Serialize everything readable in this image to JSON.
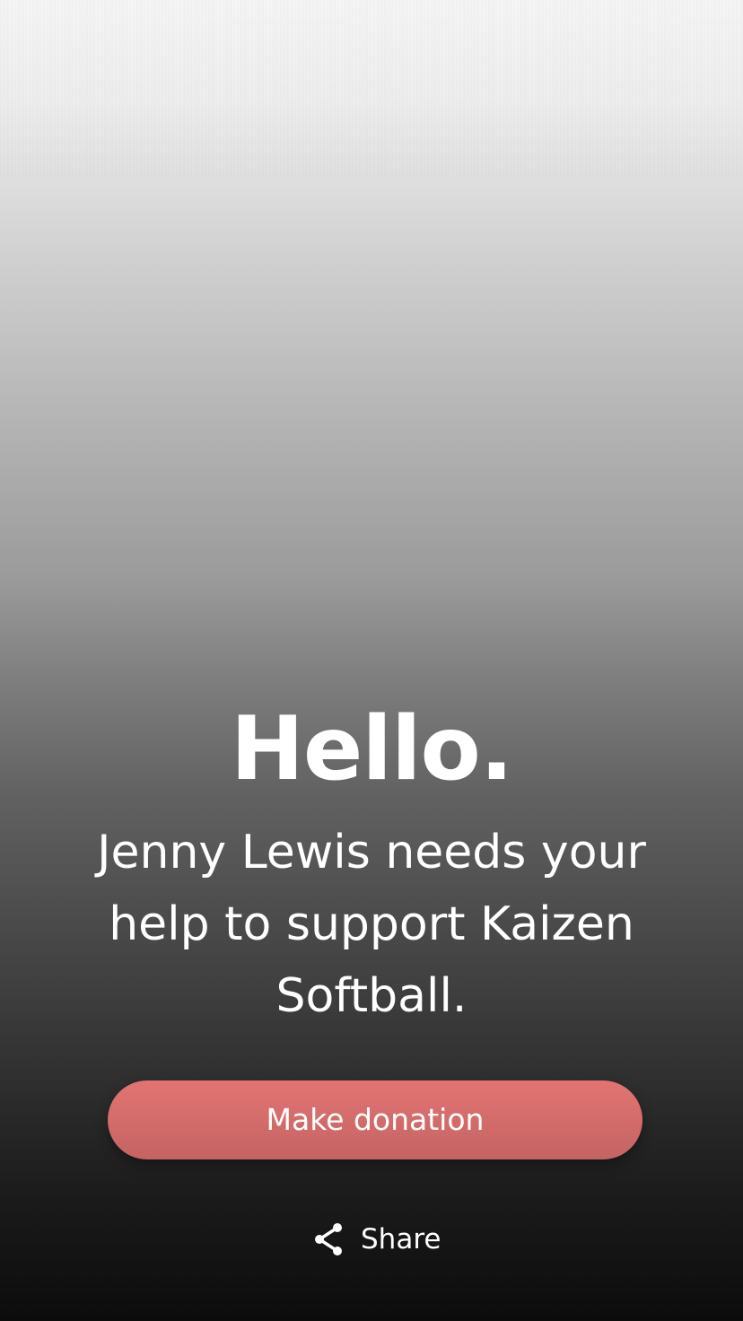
{
  "hero": {
    "greeting": "Hello.",
    "message": "Jenny Lewis needs your help to support Kaizen Softball."
  },
  "actions": {
    "donate_label": "Make donation",
    "share_label": "Share",
    "share_icon": "share-icon"
  },
  "colors": {
    "button": "#d96b6a",
    "text": "#ffffff"
  }
}
